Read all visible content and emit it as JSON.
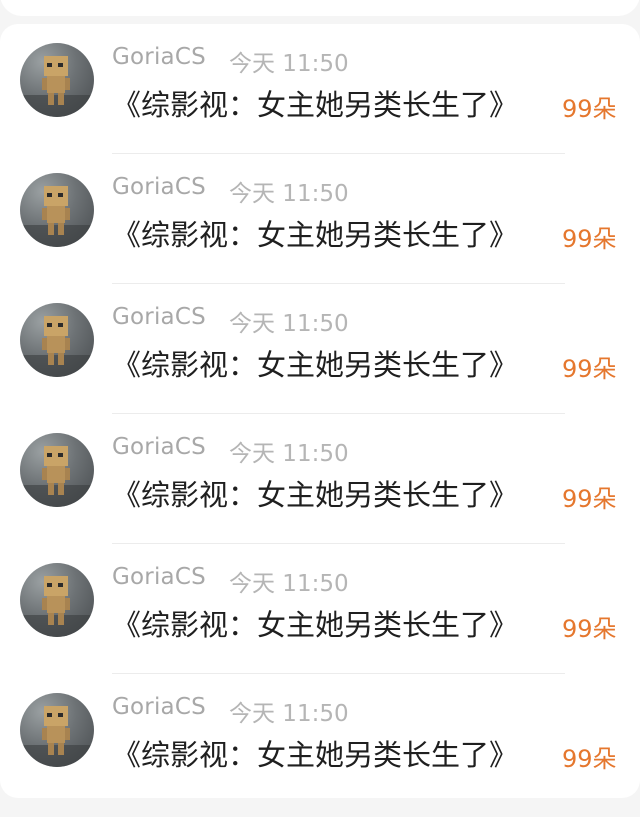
{
  "comments": [
    {
      "username": "GoriaCS",
      "time": "今天 11:50",
      "text": "《综影视：女主她另类长生了》",
      "flowers": "99朵"
    },
    {
      "username": "GoriaCS",
      "time": "今天 11:50",
      "text": "《综影视：女主她另类长生了》",
      "flowers": "99朵"
    },
    {
      "username": "GoriaCS",
      "time": "今天 11:50",
      "text": "《综影视：女主她另类长生了》",
      "flowers": "99朵"
    },
    {
      "username": "GoriaCS",
      "time": "今天 11:50",
      "text": "《综影视：女主她另类长生了》",
      "flowers": "99朵"
    },
    {
      "username": "GoriaCS",
      "time": "今天 11:50",
      "text": "《综影视：女主她另类长生了》",
      "flowers": "99朵"
    },
    {
      "username": "GoriaCS",
      "time": "今天 11:50",
      "text": "《综影视：女主她另类长生了》",
      "flowers": "99朵"
    }
  ],
  "colors": {
    "username": "#a8a8a8",
    "flowers_accent": "#e5772e",
    "comment_text": "#1f1f1f"
  },
  "avatar_icon": "cardboard-robot-avatar"
}
